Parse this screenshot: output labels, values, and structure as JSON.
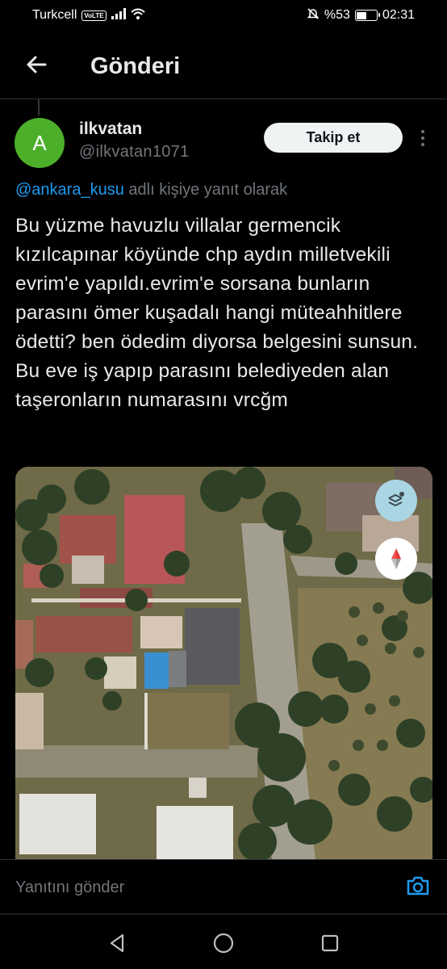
{
  "status_bar": {
    "carrier": "Turkcell",
    "volte": "VoLTE",
    "battery_text": "%53",
    "battery_level": 0.53,
    "time": "02:31"
  },
  "header": {
    "title": "Gönderi",
    "back_icon": "arrow-left-icon"
  },
  "author": {
    "avatar_letter": "A",
    "avatar_color": "#4caf2a",
    "display_name": "ilkvatan",
    "handle": "@ilkvatan1071",
    "follow_label": "Takip et"
  },
  "reply": {
    "mention": "@ankara_kusu",
    "suffix": " adlı kişiye yanıt olarak"
  },
  "tweet": {
    "text": "Bu yüzme havuzlu villalar germencik kızılcapınar köyünde chp aydın milletvekili evrim'e yapıldı.evrim'e sorsana bunların parasını ömer kuşadalı hangi müteahhitlere ödetti? ben ödedim diyorsa belgesini sunsun. Bu eve iş yapıp parasını belediyeden alan taşeronların numarasını vrcğm"
  },
  "media": {
    "type": "satellite-map-image",
    "layers_icon": "layers-icon",
    "compass_icon": "compass-icon"
  },
  "composer": {
    "placeholder": "Yanıtını gönder",
    "camera_icon": "camera-icon"
  },
  "colors": {
    "accent": "#1d9bf0",
    "background": "#000000",
    "text": "#e7e9ea",
    "muted": "#71767b"
  }
}
